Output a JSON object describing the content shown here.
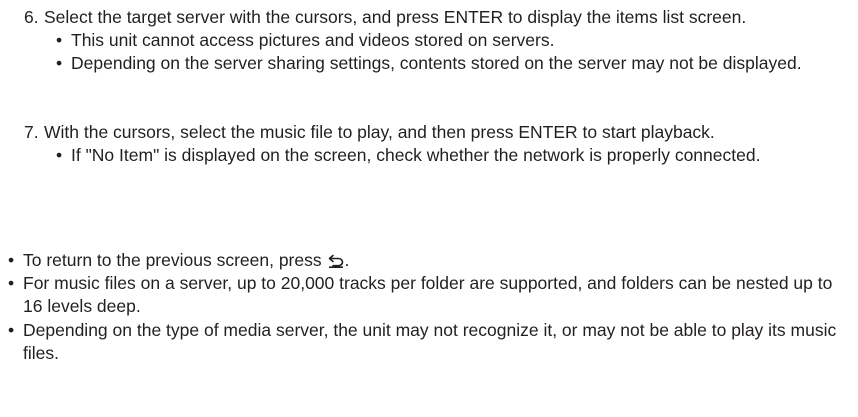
{
  "steps": [
    {
      "number": "6.",
      "text": "Select the target server with the cursors, and press ENTER to display the items list screen.",
      "bullets": [
        "This unit cannot access pictures and videos stored on servers.",
        "Depending on the server sharing settings, contents stored on the server may not be displayed."
      ]
    },
    {
      "number": "7.",
      "text": "With the cursors, select the music file to play, and then press ENTER to start playback.",
      "bullets": [
        "If \"No Item\" is displayed on the screen, check whether the network is properly connected."
      ]
    }
  ],
  "notes": {
    "return_prefix": "To return to the previous screen, press ",
    "return_suffix": ".",
    "return_icon": "return-icon",
    "folders": "For music files on a server, up to 20,000 tracks per folder are supported, and folders can be nested up to 16 levels deep.",
    "media_server": "Depending on the type of media server, the unit may not recognize it, or may not be able to play its music files."
  }
}
